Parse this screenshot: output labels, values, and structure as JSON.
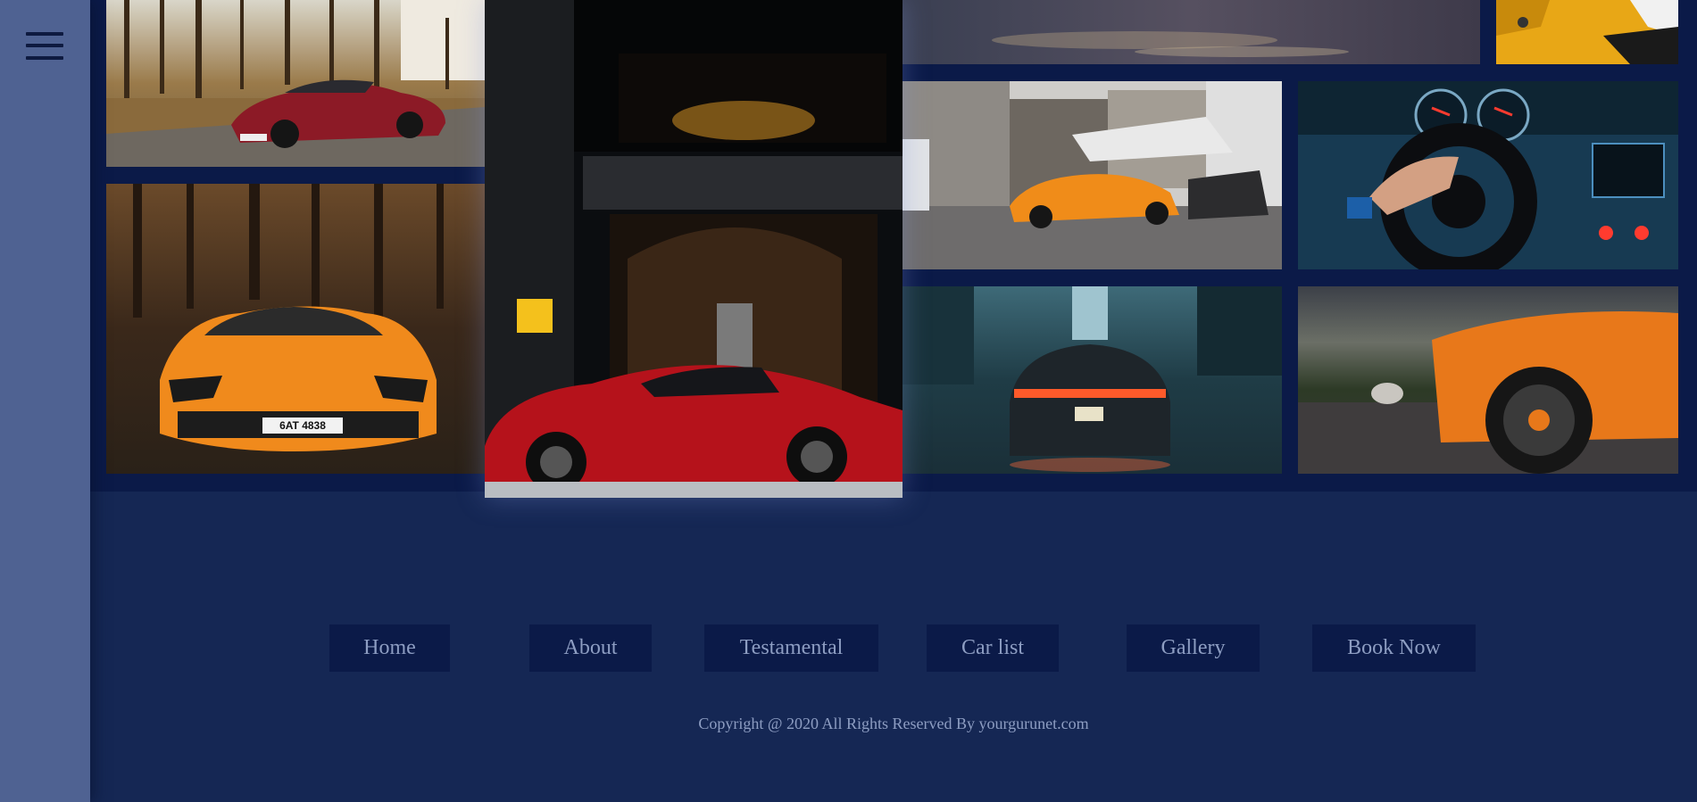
{
  "sidebar": {
    "menu_icon": "hamburger-menu-icon"
  },
  "gallery": {
    "images": [
      {
        "name": "red-sports-car-in-forest-image",
        "subject": "red coupe parked on a forest road"
      },
      {
        "name": "orange-supercar-in-woods-image",
        "subject": "orange supercar front view in dark woods",
        "plate": "6AT 4838"
      },
      {
        "name": "red-coupe-at-hotel-entrance-image",
        "subject": "red coupe parked at a hotel entrance"
      },
      {
        "name": "car-on-wet-road-image",
        "subject": "motion blur over wet asphalt"
      },
      {
        "name": "yellow-supercar-detail-image",
        "subject": "yellow supercar headlight detail"
      },
      {
        "name": "orange-supercar-city-street-image",
        "subject": "orange supercar on a city street"
      },
      {
        "name": "car-dashboard-steering-wheel-image",
        "subject": "hand on a car steering wheel and dashboard"
      },
      {
        "name": "sports-car-rear-rainy-street-image",
        "subject": "sports car rear lights on a rainy street"
      },
      {
        "name": "orange-supercar-wheel-image",
        "subject": "orange supercar side and wheel under stormy sky"
      }
    ]
  },
  "nav": {
    "home": "Home",
    "about": "About",
    "testamental": "Testamental",
    "car_list": "Car list",
    "gallery": "Gallery",
    "book_now": "Book Now"
  },
  "footer": {
    "copyright": "Copyright @ 2020 All Rights Reserved By yourgurunet.com"
  },
  "colors": {
    "page_bg": "#152754",
    "sidebar_bg": "#4f6292",
    "gallery_bg": "#0b1a48",
    "button_bg": "#0b1a48",
    "text": "#8d9dc2"
  }
}
